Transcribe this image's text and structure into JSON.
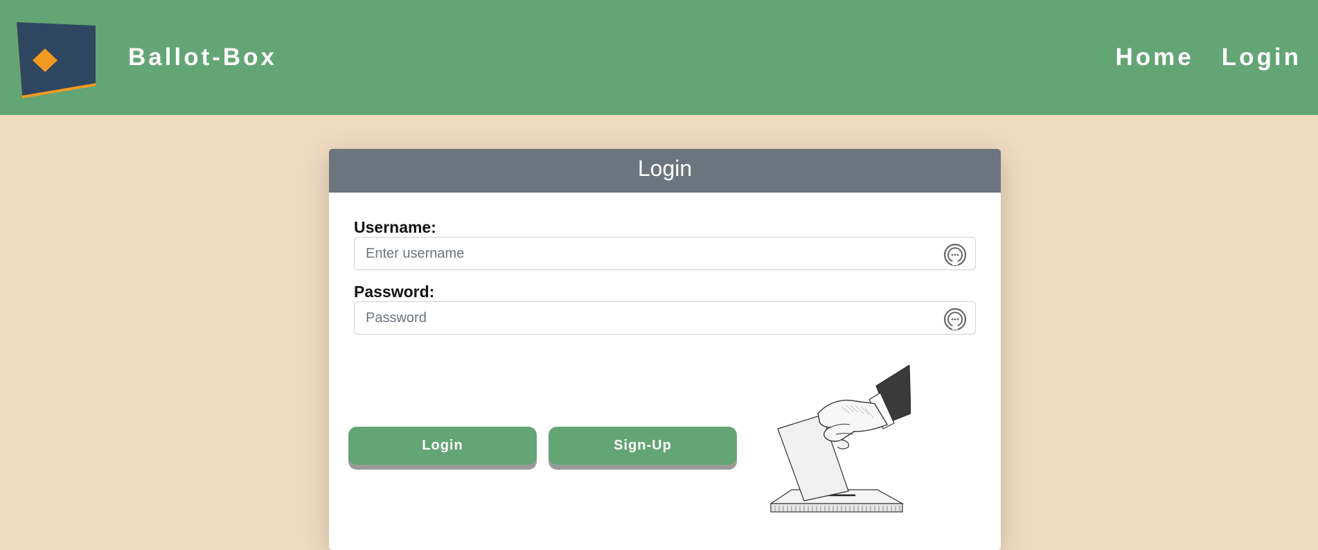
{
  "navbar": {
    "brand": "Ballot-Box",
    "links": [
      {
        "label": "Home"
      },
      {
        "label": "Login"
      }
    ]
  },
  "login_card": {
    "title": "Login",
    "username": {
      "label": "Username:",
      "placeholder": "Enter username"
    },
    "password": {
      "label": "Password:",
      "placeholder": "Password"
    },
    "buttons": {
      "login": "Login",
      "signup": "Sign-Up"
    }
  },
  "colors": {
    "navbar": "#64a575",
    "page_background": "#efdbc0",
    "card_header": "#6c757d",
    "button": "#64a575",
    "logo_square": "#2f4660",
    "logo_diamond": "#f39a22"
  },
  "icons": {
    "logo": "ballot-box-logo",
    "field_icon": "password-manager-icon",
    "illustration": "hand-casting-ballot-illustration"
  }
}
